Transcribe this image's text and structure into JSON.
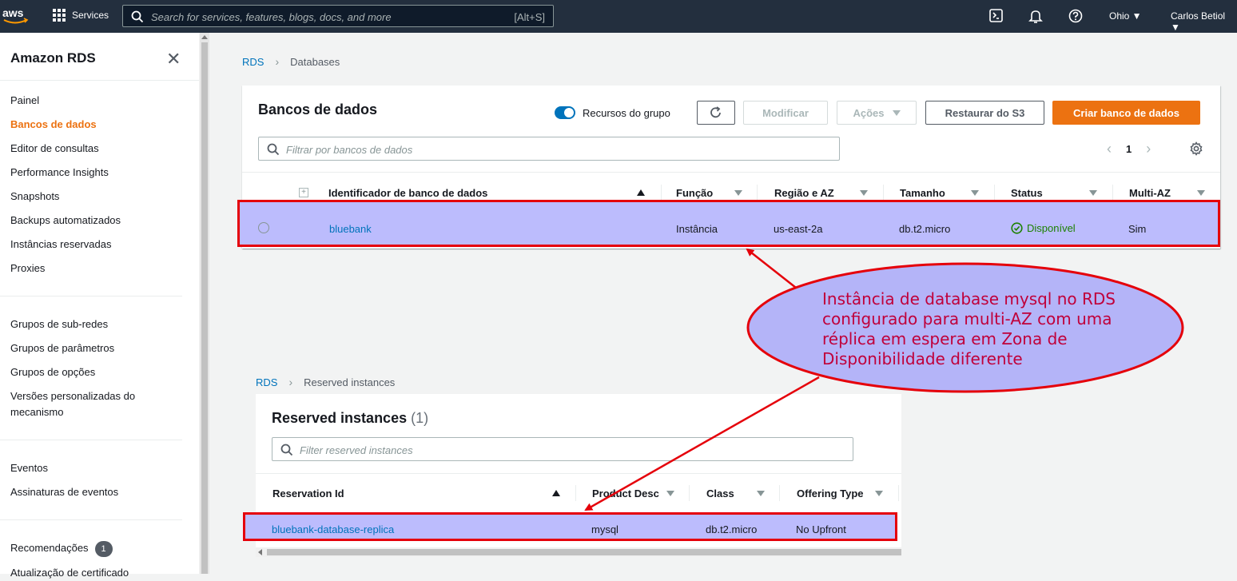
{
  "topnav": {
    "logo": "aws",
    "services_label": "Services",
    "search_placeholder": "Search for services, features, blogs, docs, and more",
    "search_shortcut": "[Alt+S]",
    "region": "Ohio ▼",
    "user": "Carlos Betiol ▼",
    "icons": [
      "cloudshell-icon",
      "bell-icon",
      "help-icon"
    ]
  },
  "sidebar": {
    "title": "Amazon RDS",
    "items_group1": [
      "Painel",
      "Bancos de dados",
      "Editor de consultas",
      "Performance Insights",
      "Snapshots",
      "Backups automatizados",
      "Instâncias reservadas",
      "Proxies"
    ],
    "active": "Bancos de dados",
    "items_group2": [
      "Grupos de sub-redes",
      "Grupos de parâmetros",
      "Grupos de opções",
      "Versões personalizadas do mecanismo"
    ],
    "items_group3": [
      "Eventos",
      "Assinaturas de eventos"
    ],
    "recommendations_label": "Recomendações",
    "recommendations_count": "1",
    "cut_item": "Atualização de certificado"
  },
  "databases": {
    "breadcrumb": {
      "root": "RDS",
      "current": "Databases"
    },
    "title": "Bancos de dados",
    "toggle_label": "Recursos do grupo",
    "buttons": {
      "modify": "Modificar",
      "actions": "Ações",
      "restore": "Restaurar do S3",
      "create": "Criar banco de dados"
    },
    "filter_placeholder": "Filtrar por bancos de dados",
    "page": "1",
    "columns": [
      "Identificador de banco de dados",
      "Função",
      "Região e AZ",
      "Tamanho",
      "Status",
      "Multi-AZ"
    ],
    "row": {
      "identifier": "bluebank",
      "role": "Instância",
      "region_az": "us-east-2a",
      "size": "db.t2.micro",
      "status": "Disponível",
      "multi_az": "Sim"
    }
  },
  "reserved": {
    "breadcrumb": {
      "root": "RDS",
      "current": "Reserved instances"
    },
    "title": "Reserved instances",
    "count": "(1)",
    "filter_placeholder": "Filter reserved instances",
    "columns": [
      "Reservation Id",
      "Product Desc",
      "Class",
      "Offering Type"
    ],
    "row": {
      "reservation_id": "bluebank-database-replica",
      "product_desc": "mysql",
      "class": "db.t2.micro",
      "offering_type": "No Upfront"
    }
  },
  "annotation": {
    "text": "Instância de database mysql no RDS configurado para multi-AZ com uma réplica em espera em Zona de Disponibilidade diferente",
    "fill": "#b4b4f8",
    "stroke": "#e5000a"
  }
}
